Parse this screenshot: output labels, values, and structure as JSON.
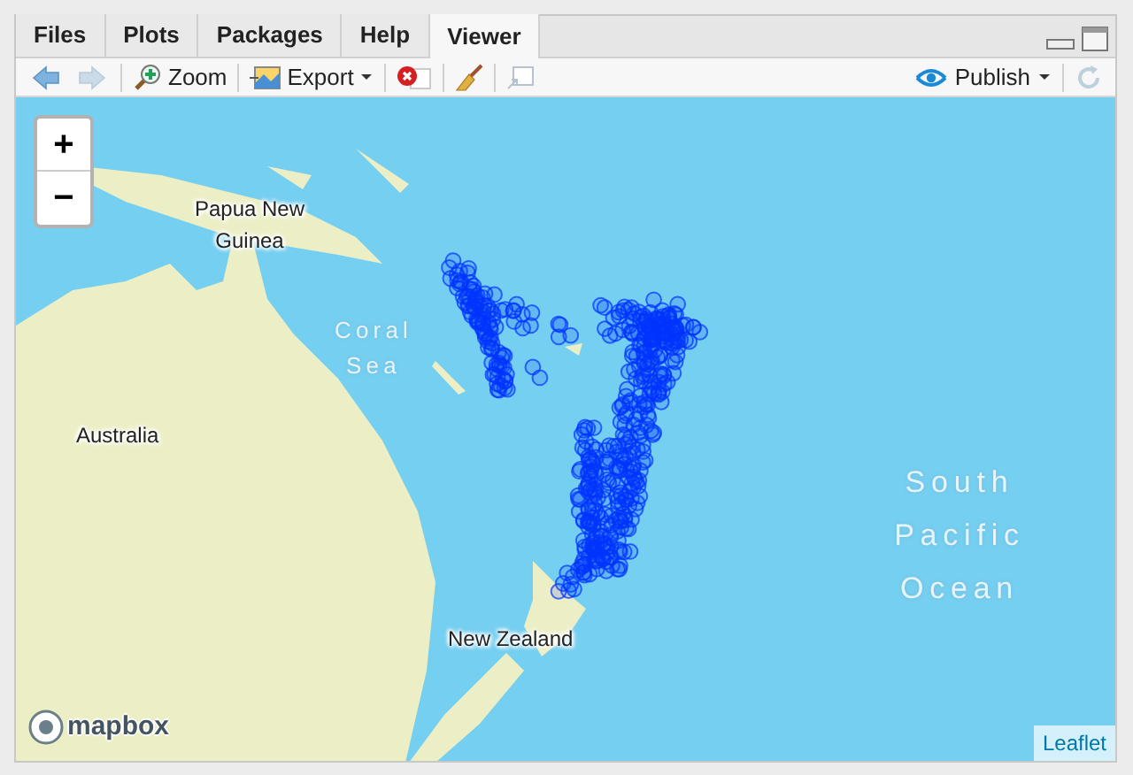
{
  "tabs": [
    {
      "label": "Files",
      "selected": false
    },
    {
      "label": "Plots",
      "selected": false
    },
    {
      "label": "Packages",
      "selected": false
    },
    {
      "label": "Help",
      "selected": false
    },
    {
      "label": "Viewer",
      "selected": true
    }
  ],
  "toolbar": {
    "nav": [
      {
        "kind": "back",
        "disabled": false
      },
      {
        "kind": "forward",
        "disabled": true
      }
    ],
    "zoom": "Zoom",
    "export": "Export",
    "publish": "Publish",
    "refresh": {
      "disabled": true
    }
  },
  "map": {
    "zoom_in": "+",
    "zoom_out": "−",
    "labels": [
      {
        "text": "Papua New Guinea",
        "kind": "place"
      },
      {
        "text": "Coral Sea",
        "kind": "water"
      },
      {
        "text": "Australia",
        "kind": "place"
      },
      {
        "text": "New Zealand",
        "kind": "place"
      },
      {
        "text": "South Pacific Ocean",
        "kind": "water"
      }
    ],
    "logo": "mapbox",
    "attribution": "Leaflet"
  }
}
